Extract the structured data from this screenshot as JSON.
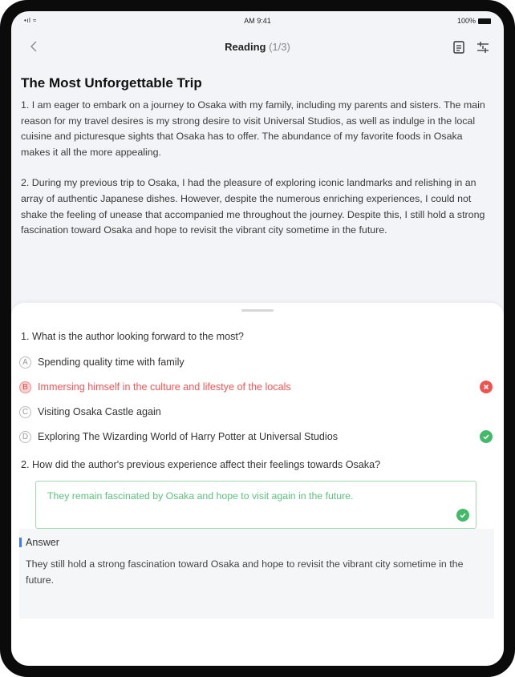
{
  "status_bar": {
    "signal": "•ıl ≈",
    "time": "AM 9:41",
    "battery": "100%"
  },
  "nav": {
    "title": "Reading",
    "progress": "(1/3)"
  },
  "article": {
    "title": "The Most Unforgettable Trip",
    "paragraphs": [
      "1. I am eager to embark on a journey to Osaka with my family, including my parents and sisters. The main reason for my travel desires is my strong desire to visit Universal Studios, as well as indulge in the local cuisine and picturesque sights that Osaka has to offer. The abundance of my favorite foods in Osaka makes it all the more appealing.",
      "2. During my previous trip to Osaka, I had the pleasure of exploring iconic landmarks and relishing in an array of authentic Japanese dishes. However, despite the numerous enriching experiences, I could not shake the feeling of unease that accompanied me throughout the journey. Despite this, I still hold a strong fascination toward Osaka and hope to revisit the vibrant city sometime in the future."
    ]
  },
  "question1": {
    "text": "1. What is the author looking forward to the most?",
    "options": [
      {
        "letter": "A",
        "label": "Spending quality time with family",
        "state": "none"
      },
      {
        "letter": "B",
        "label": "Immersing himself in the culture and lifestye of the locals",
        "state": "wrong"
      },
      {
        "letter": "C",
        "label": "Visiting Osaka Castle again",
        "state": "none"
      },
      {
        "letter": "D",
        "label": "Exploring The Wizarding World of Harry Potter at Universal Studios",
        "state": "correct"
      }
    ]
  },
  "question2": {
    "text": "2. How did the author's previous experience affect their feelings towards Osaka?",
    "response": "They remain fascinated by Osaka and hope to visit again in the future."
  },
  "answer": {
    "heading": "Answer",
    "text": "They still hold a strong fascination toward Osaka and hope to revisit the vibrant city sometime in the future."
  },
  "colors": {
    "wrong": "#f05454",
    "correct": "#43b96a",
    "accent": "#3a7cf0"
  },
  "icons": {
    "back": "chevron-left-icon",
    "document": "document-icon",
    "settings": "sliders-icon",
    "wrong": "x-circle-icon",
    "correct": "check-circle-icon"
  }
}
